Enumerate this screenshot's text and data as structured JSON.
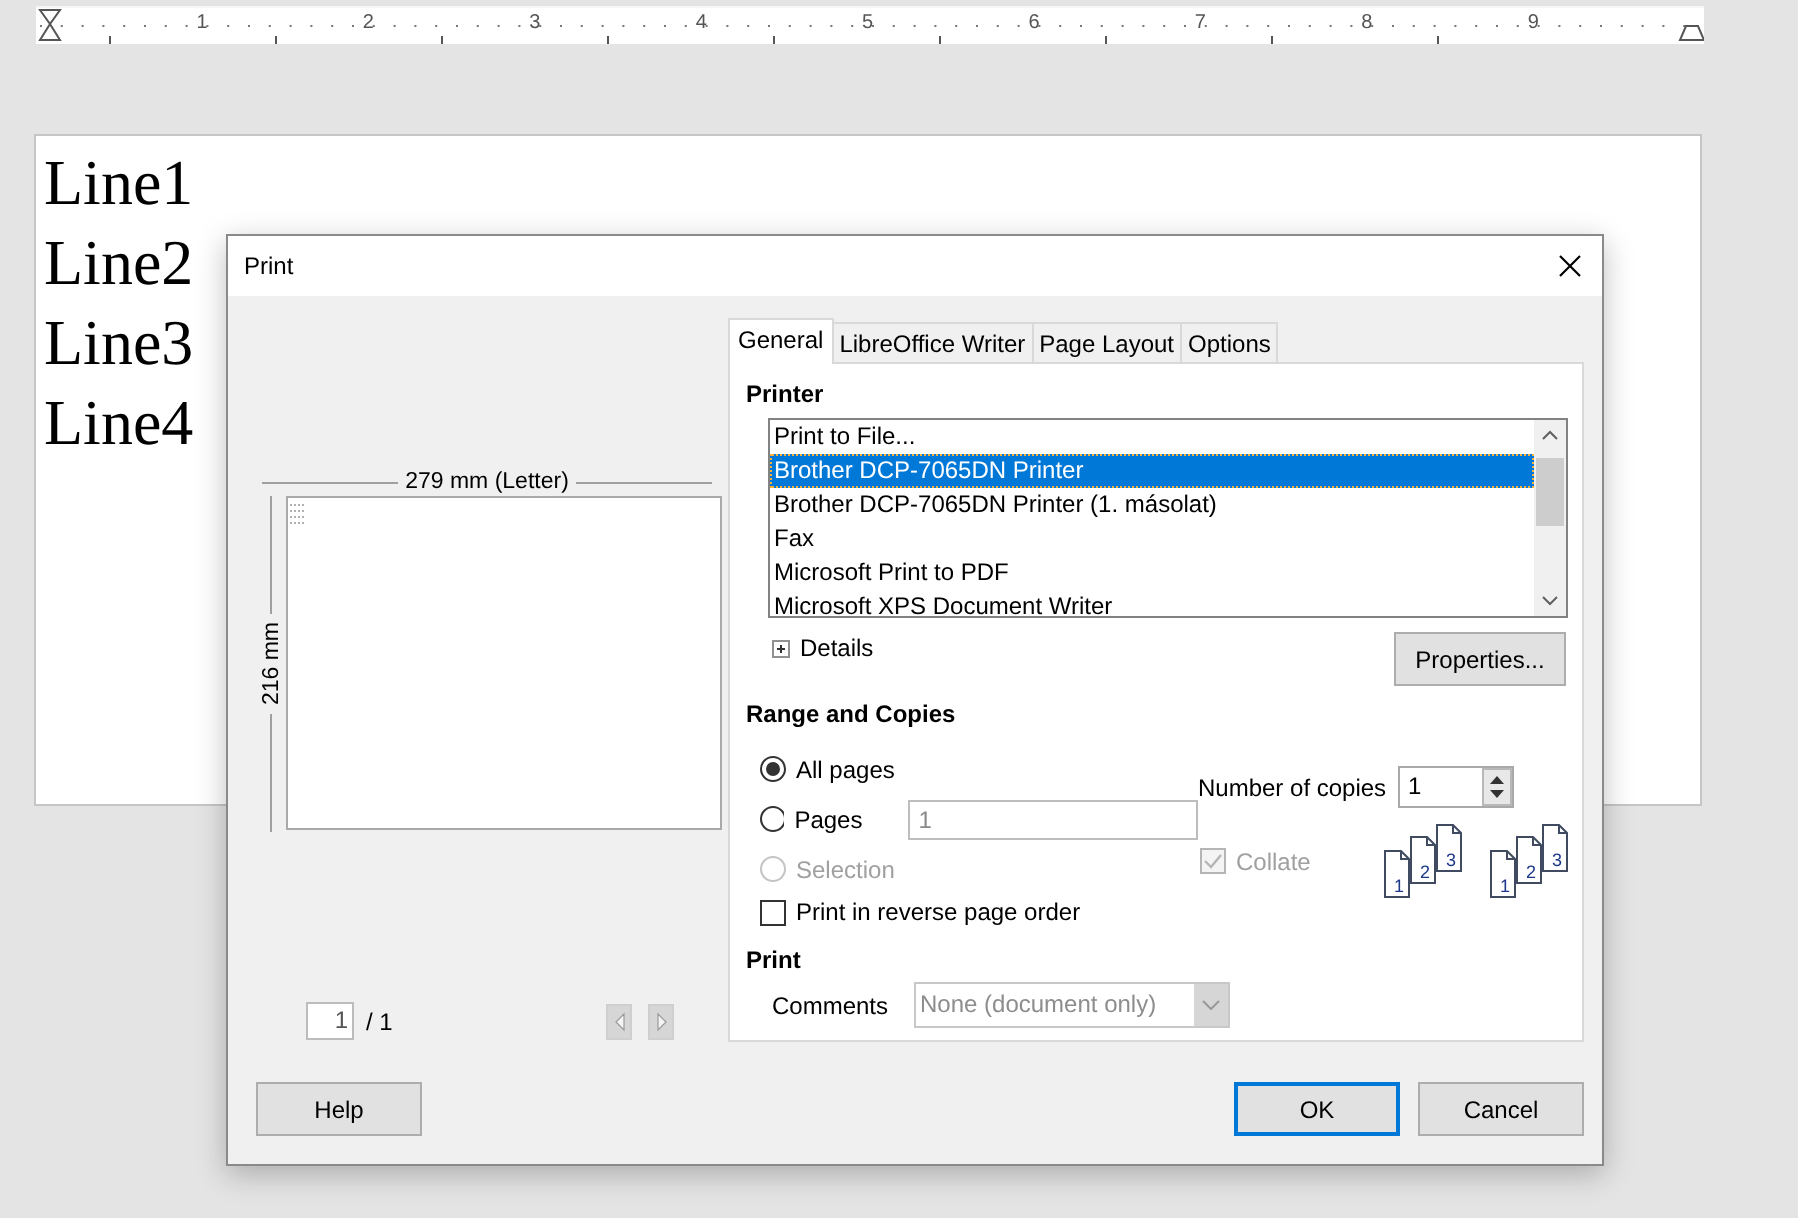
{
  "ruler": {
    "labels": [
      "1",
      "2",
      "3",
      "4",
      "5",
      "6",
      "7",
      "8",
      "9"
    ]
  },
  "document": {
    "lines": [
      "Line1",
      "Line2",
      "Line3",
      "Line4"
    ]
  },
  "dialog": {
    "title": "Print",
    "preview": {
      "width_label": "279 mm (Letter)",
      "height_label": "216 mm",
      "page": "1",
      "page_total": "/ 1"
    },
    "tabs": [
      {
        "label": "General",
        "selected": true
      },
      {
        "label": "LibreOffice Writer",
        "selected": false
      },
      {
        "label": "Page Layout",
        "selected": false
      },
      {
        "label": "Options",
        "selected": false
      }
    ],
    "printer": {
      "heading": "Printer",
      "items": [
        {
          "name": "Print to File...",
          "selected": false
        },
        {
          "name": "Brother DCP-7065DN Printer",
          "selected": true
        },
        {
          "name": "Brother DCP-7065DN Printer (1. másolat)",
          "selected": false
        },
        {
          "name": "Fax",
          "selected": false
        },
        {
          "name": "Microsoft Print to PDF",
          "selected": false
        },
        {
          "name": "Microsoft XPS Document Writer",
          "selected": false
        }
      ],
      "details": {
        "label": "Details",
        "expanded": false
      },
      "properties": "Properties..."
    },
    "range": {
      "heading": "Range and Copies",
      "options": [
        {
          "label": "All pages",
          "selected": true,
          "disabled": false
        },
        {
          "label": "Pages",
          "selected": false,
          "disabled": false,
          "value": "1"
        },
        {
          "label": "Selection",
          "selected": false,
          "disabled": true
        }
      ],
      "reverse": {
        "label": "Print in reverse page order",
        "checked": false
      },
      "copies_label": "Number of copies",
      "copies": "1",
      "collate": {
        "label": "Collate",
        "checked": true,
        "disabled": true
      },
      "collate_stacks": [
        [
          "1",
          "2",
          "3"
        ],
        [
          "1",
          "2",
          "3"
        ]
      ]
    },
    "print": {
      "heading": "Print",
      "comments_label": "Comments",
      "comments_value": "None (document only)",
      "comments_disabled": true
    },
    "buttons": [
      {
        "label": "Help",
        "default": false,
        "kind": "help"
      },
      {
        "label": "OK",
        "default": true,
        "kind": "action"
      },
      {
        "label": "Cancel",
        "default": false,
        "kind": "action"
      }
    ]
  }
}
